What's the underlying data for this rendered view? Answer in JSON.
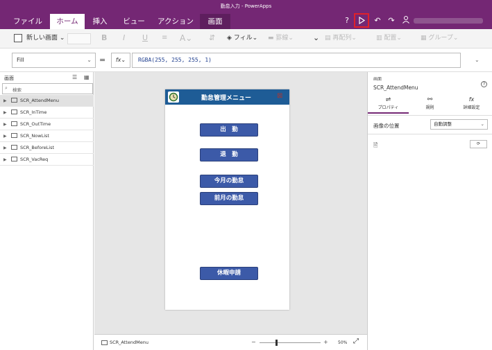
{
  "window": {
    "title": "勤怠入力 - PowerApps"
  },
  "ribbon": {
    "tabs": [
      {
        "label": "ファイル"
      },
      {
        "label": "ホーム"
      },
      {
        "label": "挿入"
      },
      {
        "label": "ビュー"
      },
      {
        "label": "アクション"
      },
      {
        "label": "画面"
      }
    ]
  },
  "toolbar": {
    "new_screen": "新しい画面",
    "fill": "フィル",
    "border": "罫線",
    "reorder": "再配列",
    "align": "配置",
    "group": "グループ"
  },
  "formula": {
    "property": "Fill",
    "equals": "=",
    "fx": "fx",
    "value": "RGBA(255, 255, 255, 1)"
  },
  "left_panel": {
    "title": "画面",
    "search_placeholder": "検索",
    "screens": [
      {
        "label": "SCR_AttendMenu"
      },
      {
        "label": "SCR_InTime"
      },
      {
        "label": "SCR_OutTime"
      },
      {
        "label": "SCR_NowList"
      },
      {
        "label": "SCR_BeforeList"
      },
      {
        "label": "SCR_VacReq"
      }
    ]
  },
  "app": {
    "header_title": "勤怠管理メニュー",
    "buttons": [
      {
        "label": "出　勤"
      },
      {
        "label": "退　勤"
      },
      {
        "label": "今月の勤怠"
      },
      {
        "label": "前月の勤怠"
      },
      {
        "label": "休暇申請"
      }
    ]
  },
  "statusbar": {
    "screen_name": "SCR_AttendMenu",
    "zoom": "50%"
  },
  "right_panel": {
    "section": "画面",
    "selected": "SCR_AttendMenu",
    "tabs": [
      {
        "label": "プロパティ"
      },
      {
        "label": "規則"
      },
      {
        "label": "詳細設定"
      }
    ],
    "image_position_label": "画像の位置",
    "image_position_value": "自動調整",
    "image_icon": "image-icon"
  },
  "colors": {
    "ribbon": "#742774",
    "app_header": "#1e5c96",
    "app_button": "#3c5aa8",
    "play_highlight": "#e0202a"
  }
}
